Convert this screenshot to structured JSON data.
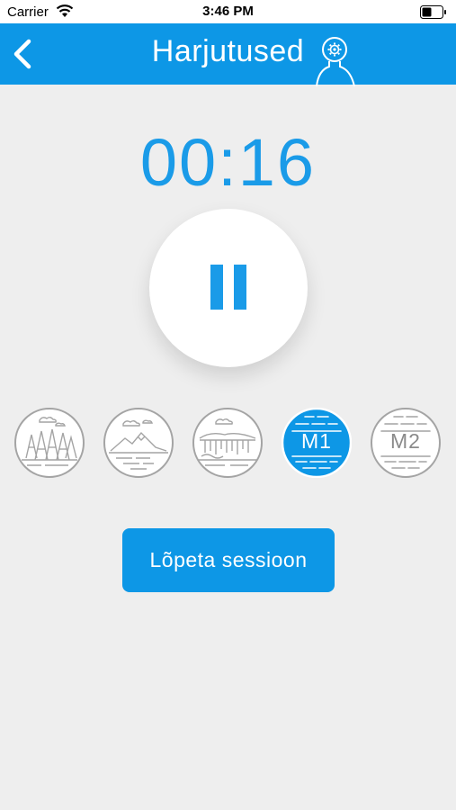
{
  "status_bar": {
    "carrier": "Carrier",
    "time": "3:46 PM"
  },
  "nav": {
    "title": "Harjutused",
    "back_icon": "chevron-left-icon",
    "profile_icon": "person-gear-icon"
  },
  "timer": {
    "value": "00:16"
  },
  "controls": {
    "pause_icon": "pause-icon"
  },
  "scenes": [
    {
      "icon": "forest-scene-icon",
      "selected": false
    },
    {
      "icon": "mountain-lake-scene-icon",
      "selected": false
    },
    {
      "icon": "waterfall-scene-icon",
      "selected": false
    },
    {
      "label": "M1",
      "selected": true
    },
    {
      "label": "M2",
      "selected": false
    }
  ],
  "end_session": {
    "label": "Lõpeta sessioon"
  },
  "colors": {
    "accent": "#0d97e6",
    "timer": "#1a9be8",
    "background": "#eeeeee",
    "scene_stroke": "#a4a4a4"
  }
}
